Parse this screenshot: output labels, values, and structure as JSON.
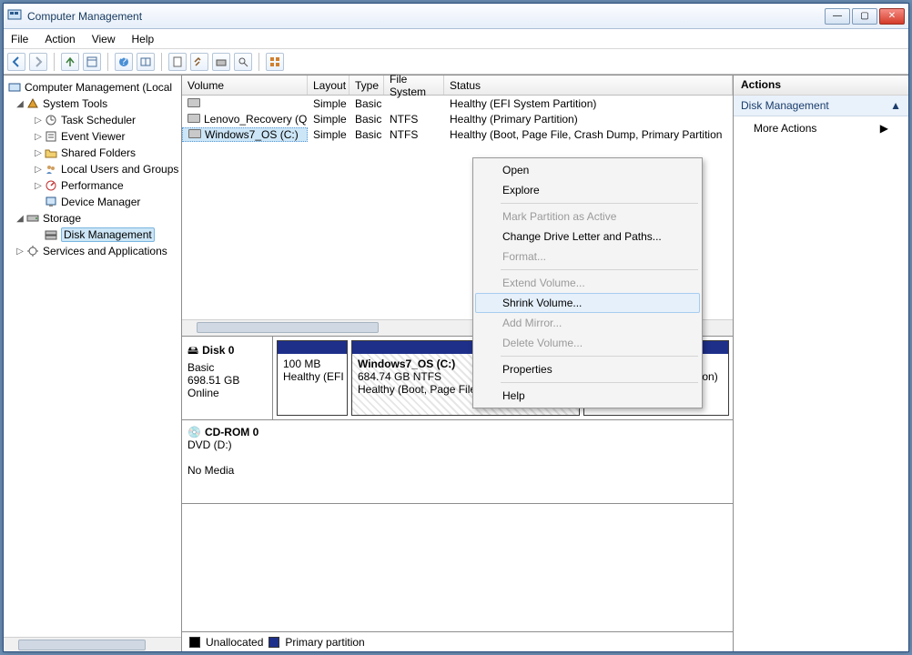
{
  "window": {
    "title": "Computer Management"
  },
  "menu": {
    "file": "File",
    "action": "Action",
    "view": "View",
    "help": "Help"
  },
  "tree": {
    "root": "Computer Management (Local",
    "systools": "System Tools",
    "task": "Task Scheduler",
    "event": "Event Viewer",
    "shared": "Shared Folders",
    "users": "Local Users and Groups",
    "perf": "Performance",
    "devmgr": "Device Manager",
    "storage": "Storage",
    "diskmgmt": "Disk Management",
    "services": "Services and Applications"
  },
  "cols": {
    "volume": "Volume",
    "layout": "Layout",
    "type": "Type",
    "fs": "File System",
    "status": "Status"
  },
  "colw": {
    "volume": 138,
    "layout": 46,
    "type": 38,
    "fs": 66,
    "status": 300
  },
  "volumes": [
    {
      "name": "",
      "layout": "Simple",
      "type": "Basic",
      "fs": "",
      "status": "Healthy (EFI System Partition)"
    },
    {
      "name": "Lenovo_Recovery (Q:)",
      "layout": "Simple",
      "type": "Basic",
      "fs": "NTFS",
      "status": "Healthy (Primary Partition)"
    },
    {
      "name": "Windows7_OS (C:)",
      "layout": "Simple",
      "type": "Basic",
      "fs": "NTFS",
      "status": "Healthy (Boot, Page File, Crash Dump, Primary Partition"
    }
  ],
  "disk0": {
    "name": "Disk 0",
    "type": "Basic",
    "size": "698.51 GB",
    "state": "Online",
    "p0_size": "100 MB",
    "p0_status": "Healthy (EFI",
    "p1_name": "Windows7_OS  (C:)",
    "p1_size": "684.74 GB NTFS",
    "p1_status": "Healthy (Boot, Page File, Crash Dump, Prir",
    "p2_status": "Healthy (Primary Partition)"
  },
  "cdrom": {
    "name": "CD-ROM 0",
    "type": "DVD (D:)",
    "state": "No Media"
  },
  "legend": {
    "unalloc": "Unallocated",
    "primary": "Primary partition"
  },
  "actions": {
    "header": "Actions",
    "section": "Disk Management",
    "more": "More Actions"
  },
  "ctx": {
    "open": "Open",
    "explore": "Explore",
    "mark": "Mark Partition as Active",
    "change": "Change Drive Letter and Paths...",
    "format": "Format...",
    "extend": "Extend Volume...",
    "shrink": "Shrink Volume...",
    "mirror": "Add Mirror...",
    "delete": "Delete Volume...",
    "props": "Properties",
    "help": "Help"
  }
}
